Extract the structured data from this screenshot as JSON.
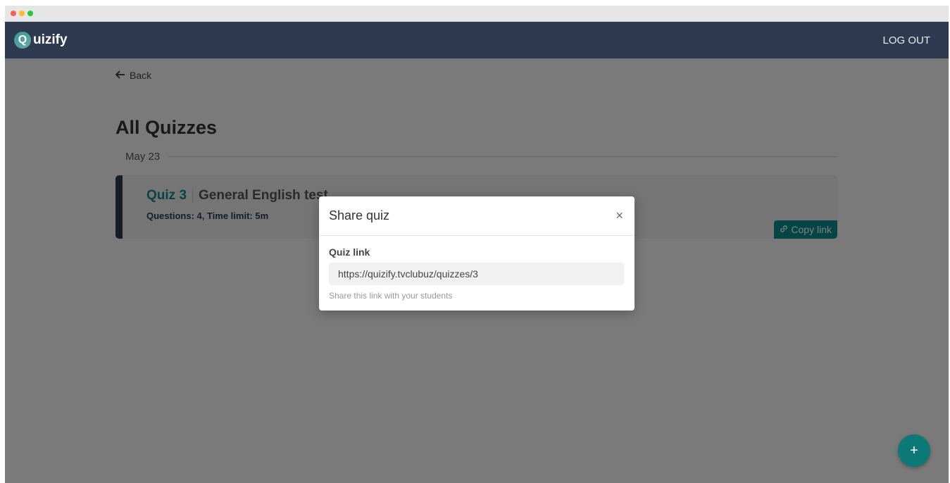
{
  "titlebar": {
    "dots": [
      "#fe5f57",
      "#febc2e",
      "#28c840"
    ]
  },
  "navbar": {
    "brand_letter": "Q",
    "brand_text": "uizify",
    "logout_label": "LOG OUT"
  },
  "main": {
    "back_label": "Back",
    "page_title": "All Quizzes",
    "groups": [
      {
        "date": "May 23",
        "quizzes": [
          {
            "number": "Quiz 3",
            "name": "General English test",
            "meta": "Questions: 4, Time limit: 5m",
            "copy_label": "Copy link"
          }
        ]
      }
    ],
    "fab_label": "+"
  },
  "modal": {
    "title": "Share quiz",
    "close_glyph": "×",
    "field_label": "Quiz link",
    "field_value": "https://quizify.tvclubuz/quizzes/3",
    "help_text": "Share this link with your students"
  },
  "colors": {
    "navbar": "#2e3a4f",
    "accent": "#0d8a8a",
    "overlay": "rgba(0,0,0,0.5)"
  }
}
